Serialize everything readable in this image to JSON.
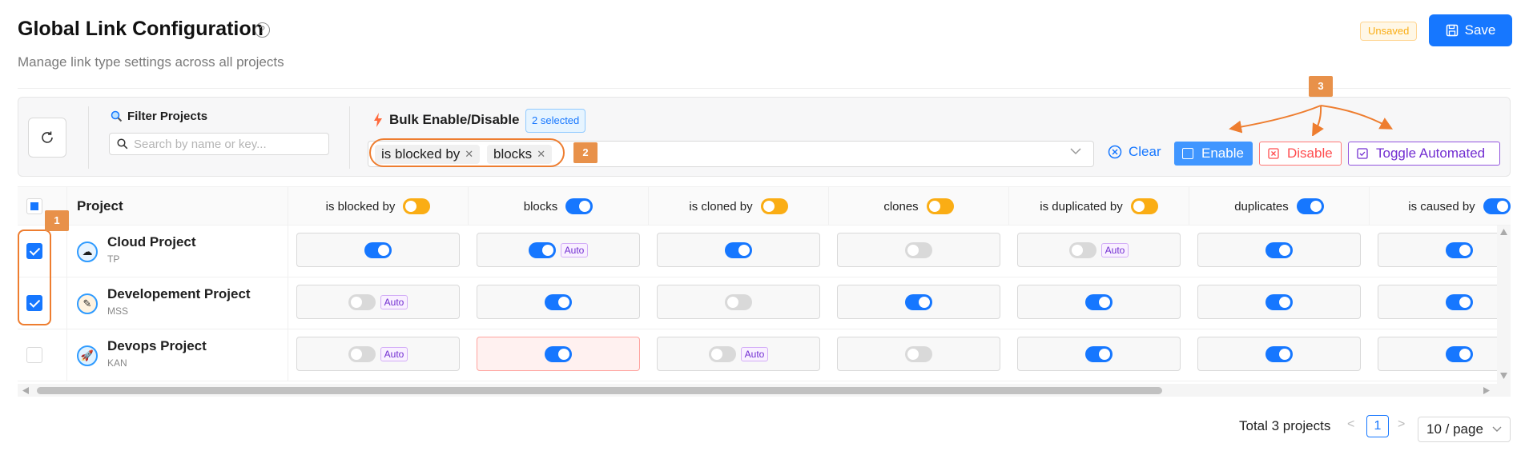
{
  "header": {
    "title": "Global Link Configuration",
    "help_icon": "question-circle-icon",
    "subtitle": "Manage link type settings across all projects",
    "unsaved_badge": "Unsaved",
    "save_label": "Save"
  },
  "filter": {
    "label": "Filter Projects",
    "placeholder": "Search by name or key..."
  },
  "bulk": {
    "label": "Bulk Enable/Disable",
    "selected_badge": "2 selected",
    "tags": [
      "is blocked by",
      "blocks"
    ],
    "clear_label": "Clear",
    "enable_label": "Enable",
    "disable_label": "Disable",
    "toggle_label": "Toggle Automated"
  },
  "markers": [
    "1",
    "2",
    "3"
  ],
  "table": {
    "project_header": "Project",
    "columns": [
      {
        "label": "is blocked by",
        "header_toggle": "partial"
      },
      {
        "label": "blocks",
        "header_toggle": "on"
      },
      {
        "label": "is cloned by",
        "header_toggle": "partial"
      },
      {
        "label": "clones",
        "header_toggle": "partial"
      },
      {
        "label": "is duplicated by",
        "header_toggle": "partial"
      },
      {
        "label": "duplicates",
        "header_toggle": "on"
      },
      {
        "label": "is caused by",
        "header_toggle": "on"
      }
    ],
    "rows": [
      {
        "name": "Cloud Project",
        "key": "TP",
        "selected": true,
        "avatar_color": "#e8f4ff",
        "cells": [
          {
            "on": true
          },
          {
            "on": true,
            "auto": true
          },
          {
            "on": true
          },
          {
            "on": false
          },
          {
            "on": false,
            "auto": true
          },
          {
            "on": true
          },
          {
            "on": true
          }
        ]
      },
      {
        "name": "Developement Project",
        "key": "MSS",
        "selected": true,
        "avatar_color": "#fff3e0",
        "cells": [
          {
            "on": false,
            "auto": true
          },
          {
            "on": true
          },
          {
            "on": false
          },
          {
            "on": true
          },
          {
            "on": true
          },
          {
            "on": true
          },
          {
            "on": true
          }
        ]
      },
      {
        "name": "Devops Project",
        "key": "KAN",
        "selected": false,
        "avatar_color": "#e0f2ff",
        "cells": [
          {
            "on": false,
            "auto": true
          },
          {
            "on": true,
            "error": true
          },
          {
            "on": false,
            "auto": true
          },
          {
            "on": false
          },
          {
            "on": true
          },
          {
            "on": true
          },
          {
            "on": true
          }
        ]
      }
    ],
    "auto_label": "Auto"
  },
  "pagination": {
    "total": "Total 3 projects",
    "current_page": "1",
    "page_size": "10 / page"
  },
  "colors": {
    "primary": "#1677ff",
    "warning": "#faad14",
    "danger": "#ff4d4f",
    "purple": "#722ed1",
    "annotation": "#ee7d2f"
  }
}
